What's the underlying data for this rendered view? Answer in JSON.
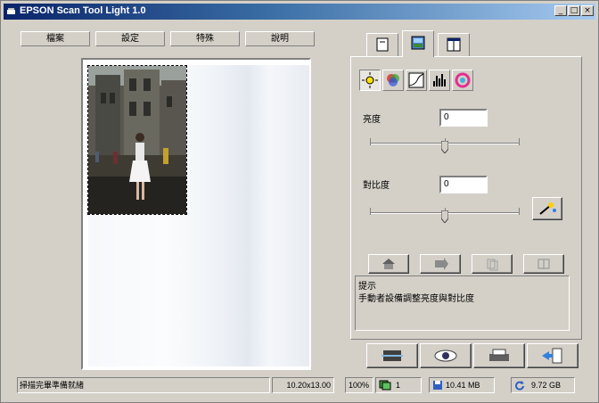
{
  "window": {
    "title": "EPSON Scan Tool Light 1.0"
  },
  "titlebar_buttons": {
    "minimize": "_",
    "maximize": "□",
    "close": "×"
  },
  "menu": {
    "items": [
      "檔案",
      "設定",
      "特殊",
      "說明"
    ]
  },
  "tabs": [
    {
      "name": "document",
      "selected": false
    },
    {
      "name": "image",
      "selected": true
    },
    {
      "name": "preview",
      "selected": false
    }
  ],
  "tools": [
    "brightness",
    "color-balance",
    "tone-curve",
    "histogram",
    "color-adjust"
  ],
  "adjust": {
    "brightness_label": "亮度",
    "brightness_value": "0",
    "brightness_level": 0.5,
    "contrast_label": "對比度",
    "contrast_value": "0",
    "contrast_level": 0.5
  },
  "hint": {
    "title": "提示",
    "text": "手動者設備調整亮度與對比度"
  },
  "status": {
    "message": "掃描完畢準備就緒",
    "dimensions": "10.20x13.00",
    "zoom": "100%",
    "count": "1",
    "memory": "10.41 MB",
    "space": "9.72 GB"
  },
  "colors": {
    "titlebar_start": "#0a246a",
    "titlebar_end": "#a6caf0",
    "face": "#d4d0c8"
  }
}
